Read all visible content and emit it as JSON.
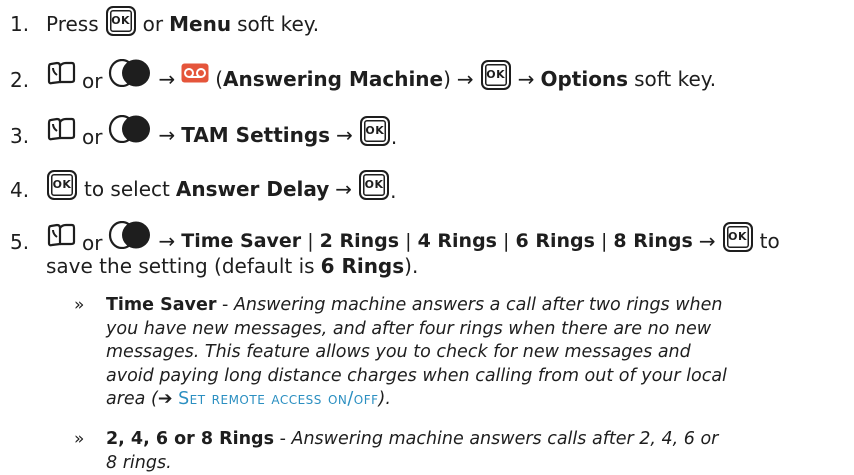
{
  "steps": [
    {
      "num": "1.",
      "press": "Press",
      "ok": "OK",
      "or": "or",
      "menu": "Menu",
      "softkey": "soft key."
    },
    {
      "num": "2.",
      "or": "or",
      "arrow": "→",
      "paren_open": "(",
      "am": "Answering Machine",
      "paren_close": ")",
      "ok": "OK",
      "options": "Options",
      "softkey": "soft key."
    },
    {
      "num": "3.",
      "or": "or",
      "arrow": "→",
      "tam": "TAM Settings",
      "ok": "OK",
      "period": "."
    },
    {
      "num": "4.",
      "ok": "OK",
      "to_select": "to select",
      "answer_delay": "Answer Delay",
      "arrow": "→",
      "period": "."
    },
    {
      "num": "5.",
      "or": "or",
      "arrow": "→",
      "opt1": "Time Saver",
      "opt2": "2 Rings",
      "opt3": "4 Rings",
      "opt4": "6 Rings",
      "opt5": "8 Rings",
      "sep": "|",
      "ok": "OK",
      "to": "to",
      "line2_pre": "save the setting (default is",
      "line2_bold": "6 Rings",
      "line2_post": ")."
    }
  ],
  "notes": [
    {
      "bullet": "»",
      "term": "Time Saver",
      "dash": "-",
      "text": "Answering machine answers a call after two rings when you have new messages, and after four rings when there are no new messages. This feature allows you to check for new messages and avoid paying long distance charges when calling from out of your local area (",
      "arrow": "➔",
      "link": "Set remote access on/off",
      "close": ")."
    },
    {
      "bullet": "»",
      "term": "2, 4, 6 or 8 Rings",
      "dash": "-",
      "text": "Answering machine answers calls after 2, 4, 6 or 8 rings."
    }
  ],
  "icons": {
    "book": "phonebook-icon",
    "nav": "navigation-key-icon",
    "tam": "answering-machine-icon"
  },
  "colors": {
    "text": "#1e1e1e",
    "link": "#2b8fc1",
    "tam_icon": "#e5553b"
  }
}
